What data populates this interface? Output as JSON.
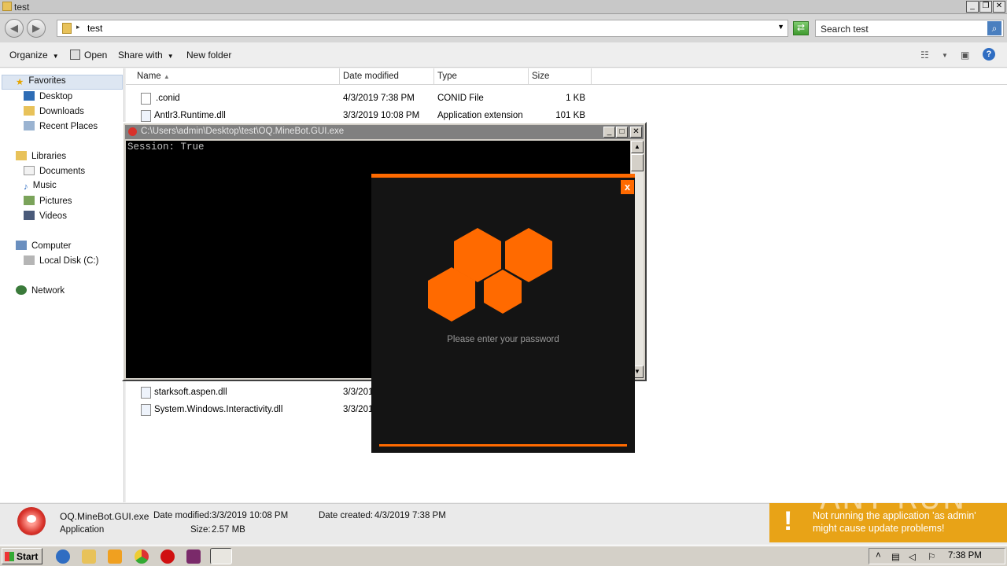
{
  "explorer": {
    "title": "test",
    "address_path": "test",
    "search_placeholder": "Search test",
    "toolbar": {
      "organize": "Organize",
      "open": "Open",
      "share_with": "Share with",
      "new_folder": "New folder"
    },
    "nav": {
      "favorites": "Favorites",
      "desktop": "Desktop",
      "downloads": "Downloads",
      "recent_places": "Recent Places",
      "libraries": "Libraries",
      "documents": "Documents",
      "music": "Music",
      "pictures": "Pictures",
      "videos": "Videos",
      "computer": "Computer",
      "local_disk": "Local Disk (C:)",
      "network": "Network"
    },
    "columns": {
      "name": "Name",
      "date_modified": "Date modified",
      "type": "Type",
      "size": "Size"
    },
    "files": [
      {
        "name": ".conid",
        "date": "4/3/2019 7:38 PM",
        "type": "CONID File",
        "size": "1 KB"
      },
      {
        "name": "Antlr3.Runtime.dll",
        "date": "3/3/2019 10:08 PM",
        "type": "Application extension",
        "size": "101 KB"
      },
      {
        "name": "starksoft.aspen.dll",
        "date": "3/3/201",
        "type": "",
        "size": ""
      },
      {
        "name": "System.Windows.Interactivity.dll",
        "date": "3/3/201",
        "type": "",
        "size": ""
      }
    ],
    "details": {
      "filename": "OQ.MineBot.GUI.exe",
      "kind": "Application",
      "date_modified_label": "Date modified:",
      "date_modified": "3/3/2019 10:08 PM",
      "size_label": "Size:",
      "size": "2.57 MB",
      "date_created_label": "Date created:",
      "date_created": "4/3/2019 7:38 PM"
    }
  },
  "console": {
    "title": "C:\\Users\\admin\\Desktop\\test\\OQ.MineBot.GUI.exe",
    "output": "Session: True"
  },
  "password_dialog": {
    "close": "x",
    "prompt": "Please enter your password",
    "accent": "#ff6a00"
  },
  "toast": {
    "icon": "!",
    "message": "Not running the application 'as admin' might cause update problems!",
    "watermark": "ANY RUN"
  },
  "taskbar": {
    "start": "Start",
    "clock": "7:38 PM"
  }
}
